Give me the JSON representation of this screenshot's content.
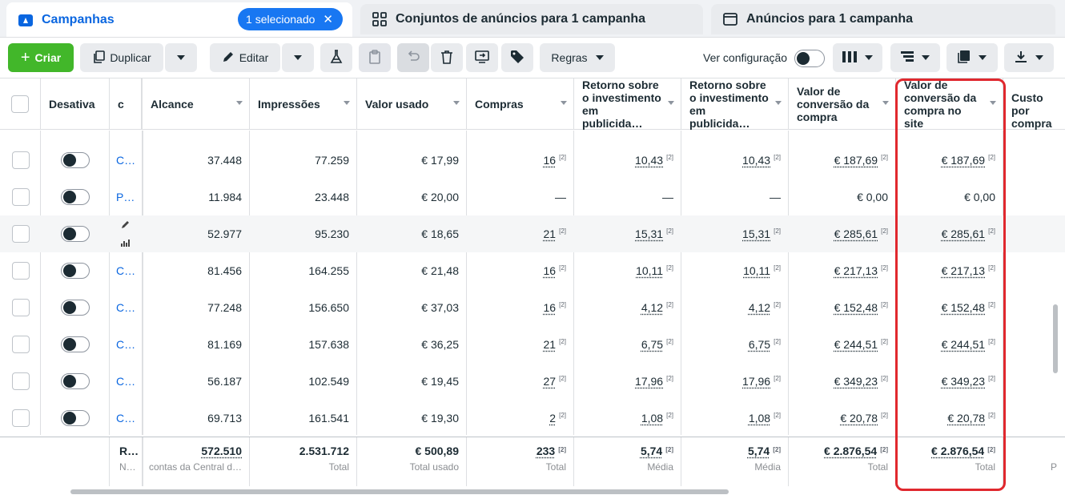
{
  "tabs": {
    "campaigns_label": "Campanhas",
    "selected_pill": "1 selecionado",
    "adsets_label": "Conjuntos de anúncios para 1 campanha",
    "ads_label": "Anúncios para 1 campanha"
  },
  "toolbar": {
    "create": "Criar",
    "duplicate": "Duplicar",
    "edit": "Editar",
    "rules": "Regras",
    "view_config": "Ver configuração"
  },
  "headers": {
    "disable": "Desativa",
    "c": "c",
    "reach": "Alcance",
    "impressions": "Impressões",
    "spent": "Valor usado",
    "purchases": "Compras",
    "roas1": "Retorno sobre o investimento em publicida…",
    "roas2": "Retorno sobre o investimento em publicida…",
    "conv_value": "Valor de conversão da compra",
    "conv_value_site": "Valor de conversão da compra no site",
    "cost_per": "Custo por compra"
  },
  "rows": [
    {
      "name": "C…",
      "reach": "37.448",
      "impressions": "77.259",
      "spent": "€ 17,99",
      "purchases": "16",
      "roas1": "10,43",
      "roas2": "10,43",
      "conv": "€ 187,69",
      "conv_site": "€ 187,69",
      "fn": "[2]",
      "empty": false
    },
    {
      "name": "P…",
      "reach": "11.984",
      "impressions": "23.448",
      "spent": "€ 20,00",
      "purchases": "—",
      "roas1": "—",
      "roas2": "—",
      "conv": "€ 0,00",
      "conv_site": "€ 0,00",
      "fn": "",
      "empty": true
    },
    {
      "name": "",
      "reach": "52.977",
      "impressions": "95.230",
      "spent": "€ 18,65",
      "purchases": "21",
      "roas1": "15,31",
      "roas2": "15,31",
      "conv": "€ 285,61",
      "conv_site": "€ 285,61",
      "fn": "[2]",
      "empty": false
    },
    {
      "name": "C…",
      "reach": "81.456",
      "impressions": "164.255",
      "spent": "€ 21,48",
      "purchases": "16",
      "roas1": "10,11",
      "roas2": "10,11",
      "conv": "€ 217,13",
      "conv_site": "€ 217,13",
      "fn": "[2]",
      "empty": false
    },
    {
      "name": "C…",
      "reach": "77.248",
      "impressions": "156.650",
      "spent": "€ 37,03",
      "purchases": "16",
      "roas1": "4,12",
      "roas2": "4,12",
      "conv": "€ 152,48",
      "conv_site": "€ 152,48",
      "fn": "[2]",
      "empty": false
    },
    {
      "name": "C…",
      "reach": "81.169",
      "impressions": "157.638",
      "spent": "€ 36,25",
      "purchases": "21",
      "roas1": "6,75",
      "roas2": "6,75",
      "conv": "€ 244,51",
      "conv_site": "€ 244,51",
      "fn": "[2]",
      "empty": false
    },
    {
      "name": "C…",
      "reach": "56.187",
      "impressions": "102.549",
      "spent": "€ 19,45",
      "purchases": "27",
      "roas1": "17,96",
      "roas2": "17,96",
      "conv": "€ 349,23",
      "conv_site": "€ 349,23",
      "fn": "[2]",
      "empty": false
    },
    {
      "name": "C…",
      "reach": "69.713",
      "impressions": "161.541",
      "spent": "€ 19,30",
      "purchases": "2",
      "roas1": "1,08",
      "roas2": "1,08",
      "conv": "€ 20,78",
      "conv_site": "€ 20,78",
      "fn": "[2]",
      "empty": false
    }
  ],
  "totals": {
    "name_top": "R…",
    "name_bottom": "N…",
    "reach": "572.510",
    "reach_sub": "contas da Central d…",
    "impressions": "2.531.712",
    "impressions_sub": "Total",
    "spent": "€ 500,89",
    "spent_sub": "Total usado",
    "purchases": "233",
    "purchases_sub": "Total",
    "roas1": "5,74",
    "roas1_sub": "Média",
    "roas2": "5,74",
    "roas2_sub": "Média",
    "conv": "€ 2.876,54",
    "conv_sub": "Total",
    "conv_site": "€ 2.876,54",
    "conv_site_sub": "Total",
    "cost_sub": "P",
    "fn": "[2]"
  },
  "colors": {
    "accent": "#1877f2",
    "create_green": "#42b72a",
    "highlight_red": "#e0282e"
  }
}
